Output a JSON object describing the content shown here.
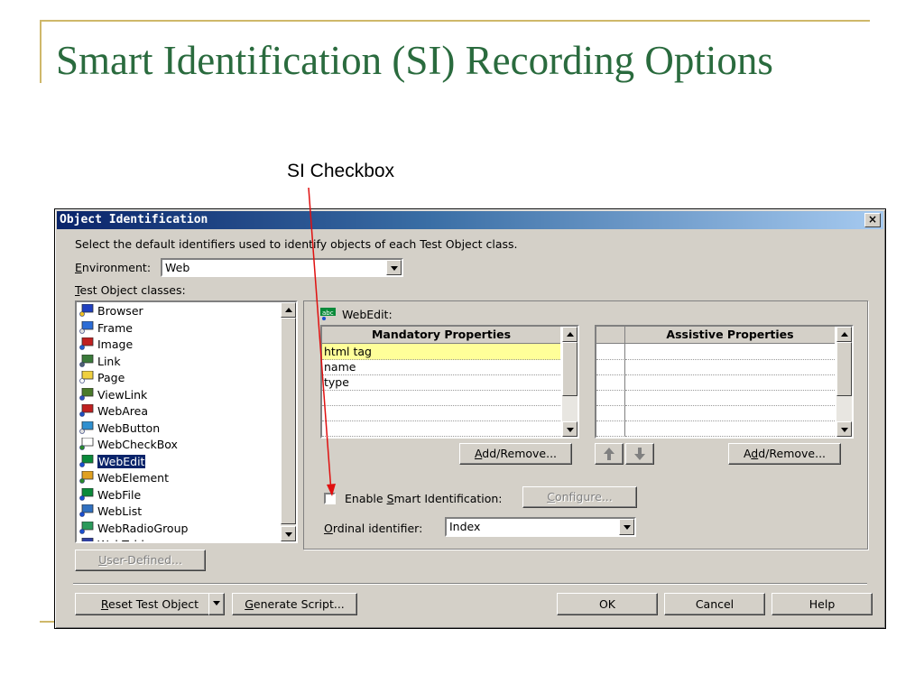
{
  "slide": {
    "title": "Smart Identification (SI) Recording Options",
    "callout": "SI Checkbox",
    "accent_color": "#2a6b3e",
    "rule_color": "#cfb86a",
    "arrow_color": "#e01010"
  },
  "dialog": {
    "title": "Object Identification",
    "close": "×",
    "description": "Select the default identifiers used to identify objects of each Test Object class.",
    "environment": {
      "label_u": "E",
      "label_rest": "nvironment:",
      "value": "Web"
    },
    "test_object_classes": {
      "label_u": "T",
      "label_rest": "est Object classes:"
    },
    "classes": [
      {
        "label": "Browser",
        "icon": "browser-icon"
      },
      {
        "label": "Frame",
        "icon": "frame-icon"
      },
      {
        "label": "Image",
        "icon": "image-icon"
      },
      {
        "label": "Link",
        "icon": "link-icon"
      },
      {
        "label": "Page",
        "icon": "page-icon"
      },
      {
        "label": "ViewLink",
        "icon": "viewlink-icon"
      },
      {
        "label": "WebArea",
        "icon": "webarea-icon"
      },
      {
        "label": "WebButton",
        "icon": "webbutton-icon"
      },
      {
        "label": "WebCheckBox",
        "icon": "webcheckbox-icon"
      },
      {
        "label": "WebEdit",
        "icon": "webedit-icon"
      },
      {
        "label": "WebElement",
        "icon": "webelement-icon"
      },
      {
        "label": "WebFile",
        "icon": "webfile-icon"
      },
      {
        "label": "WebList",
        "icon": "weblist-icon"
      },
      {
        "label": "WebRadioGroup",
        "icon": "webradiogroup-icon"
      },
      {
        "label": "WebTable",
        "icon": "webtable-icon"
      }
    ],
    "selected_class": "WebEdit",
    "group_caption": "WebEdit:",
    "mandatory": {
      "header": "Mandatory Properties",
      "rows": [
        "html tag",
        "name",
        "type",
        "",
        "",
        ""
      ]
    },
    "assistive": {
      "header": "Assistive Properties",
      "rows": [
        "",
        "",
        "",
        "",
        "",
        ""
      ]
    },
    "buttons": {
      "add_remove_1": {
        "u": "A",
        "rest": "dd/Remove..."
      },
      "add_remove_2": {
        "pre": "A",
        "u": "d",
        "rest": "d/Remove..."
      },
      "configure": {
        "u": "C",
        "rest": "onfigure..."
      },
      "user_defined": {
        "u": "U",
        "rest": "ser-Defined..."
      },
      "reset": {
        "u": "R",
        "rest": "eset Test Object"
      },
      "generate": {
        "u": "G",
        "rest": "enerate Script..."
      },
      "ok": "OK",
      "cancel": "Cancel",
      "help": "Help"
    },
    "smart_id": {
      "pre": "Enable ",
      "u": "S",
      "rest": "mart Identification:",
      "checked": false
    },
    "ordinal": {
      "label_u": "O",
      "label_rest": "rdinal identifier:",
      "value": "Index"
    }
  }
}
